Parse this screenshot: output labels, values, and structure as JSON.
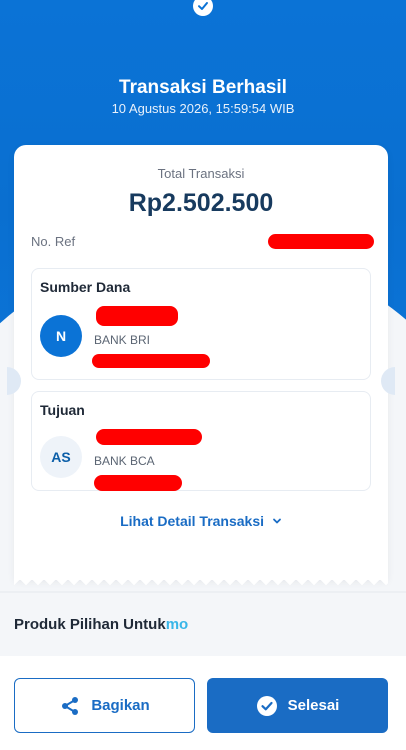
{
  "header": {
    "title": "Transaksi Berhasil",
    "datetime": "10 Agustus 2026, 15:59:54 WIB",
    "success_icon": "check-icon"
  },
  "receipt": {
    "total_label": "Total Transaksi",
    "total_amount": "Rp2.502.500",
    "ref_label": "No. Ref",
    "source": {
      "title": "Sumber Dana",
      "avatar_initial": "N",
      "bank": "BANK BRI"
    },
    "destination": {
      "title": "Tujuan",
      "avatar_initial": "AS",
      "bank": "BANK BCA"
    },
    "detail_link": "Lihat Detail Transaksi"
  },
  "product": {
    "label": "Produk Pilihan Untuk",
    "brand_suffix": "mo"
  },
  "actions": {
    "share_label": "Bagikan",
    "done_label": "Selesai"
  },
  "colors": {
    "primary": "#0b73d6",
    "link": "#1a6cc4",
    "redaction": "#ff0000"
  }
}
